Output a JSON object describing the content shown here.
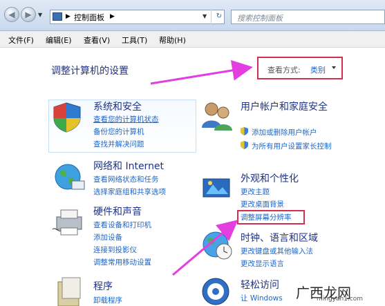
{
  "address_bar": {
    "breadcrumb_root": "控制面板",
    "search_placeholder": "搜索控制面板"
  },
  "menu": [
    "文件(F)",
    "编辑(E)",
    "查看(V)",
    "工具(T)",
    "帮助(H)"
  ],
  "page": {
    "title": "调整计算机的设置",
    "view_by_label": "查看方式:",
    "view_by_value": "类别"
  },
  "categories": [
    {
      "title": "系统和安全",
      "links": [
        "查看您的计算机状态",
        "备份您的计算机",
        "查找并解决问题"
      ]
    },
    {
      "title": "网络和 Internet",
      "links": [
        "查看网络状态和任务",
        "选择家庭组和共享选项"
      ]
    },
    {
      "title": "硬件和声音",
      "links": [
        "查看设备和打印机",
        "添加设备",
        "连接到投影仪",
        "调整常用移动设置"
      ]
    },
    {
      "title": "程序",
      "links": [
        "卸载程序"
      ]
    },
    {
      "title": "用户帐户和家庭安全",
      "links": [
        "添加或删除用户帐户",
        "为所有用户设置家长控制"
      ]
    },
    {
      "title": "外观和个性化",
      "links": [
        "更改主题",
        "更改桌面背景",
        "调整屏幕分辨率"
      ]
    },
    {
      "title": "时钟、语言和区域",
      "links": [
        "更改键盘或其他输入法",
        "更改显示语言"
      ]
    },
    {
      "title": "轻松访问",
      "links": [
        "让 Windows"
      ]
    }
  ],
  "watermark": {
    "logo": "广西龙网",
    "url": "mingyan1.com"
  },
  "colors": {
    "accent_red": "#d32e4d",
    "arrow_magenta": "#e23ee0",
    "link_blue": "#1e66c9",
    "title_blue": "#1e3287"
  }
}
